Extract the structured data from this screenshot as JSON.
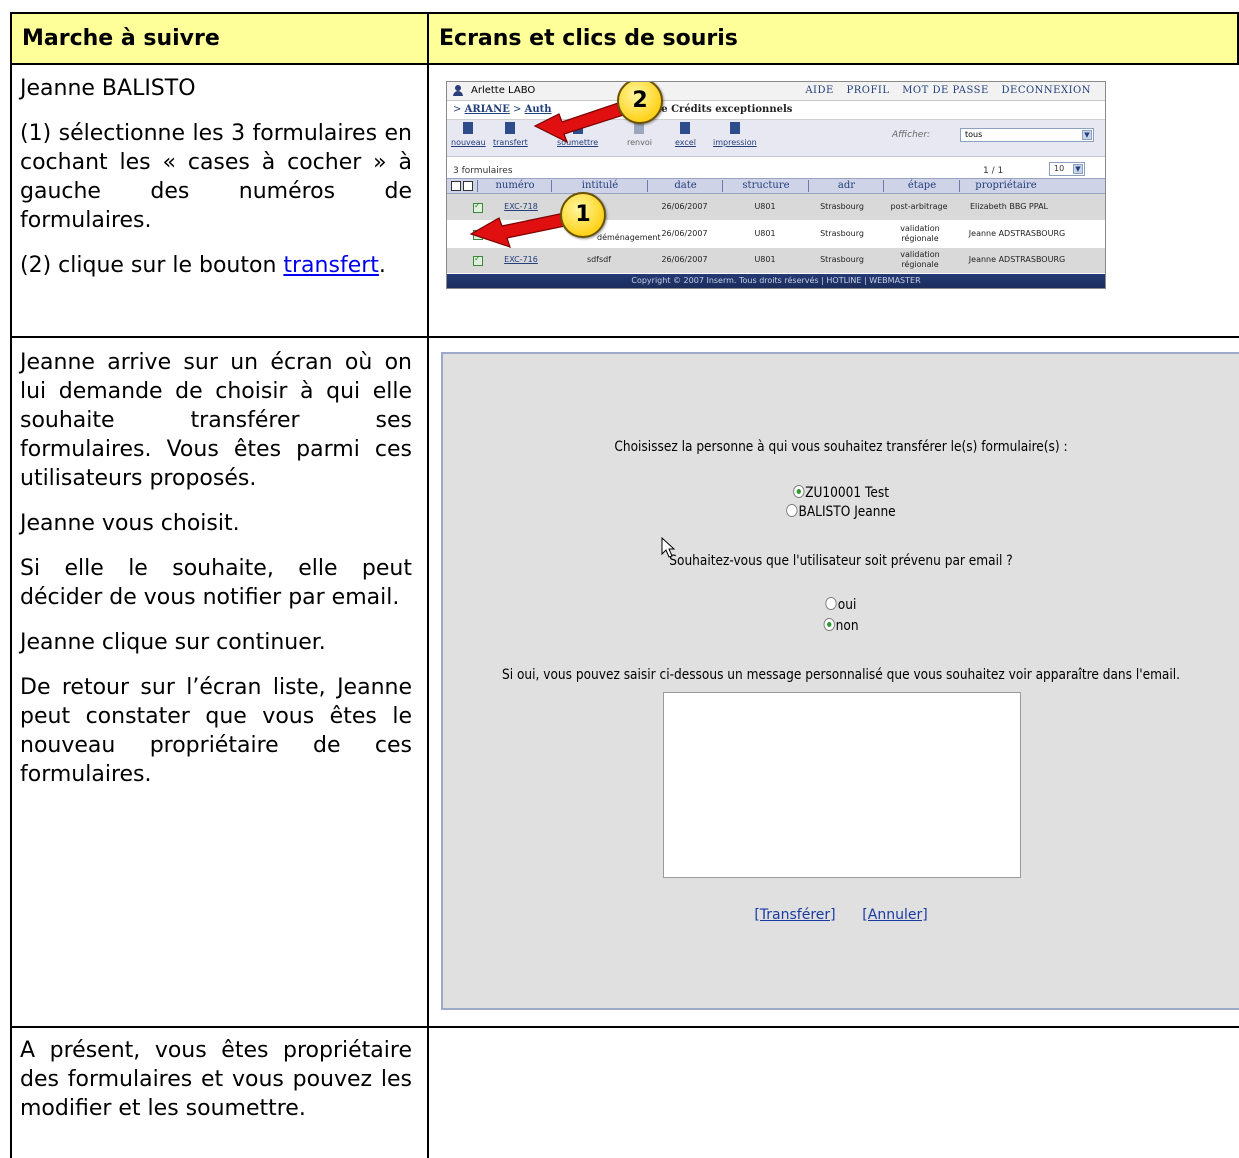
{
  "table": {
    "header_col1": "Marche à suivre",
    "header_col2": "Ecrans et clics de souris",
    "row1": {
      "p1": "Jeanne BALISTO",
      "p2": "(1) sélectionne les 3 formulaires en cochant les « cases à cocher » à gauche des numéros de formulaires.",
      "p3_before": "(2) clique sur le bouton ",
      "p3_link": "transfert",
      "p3_after": "."
    },
    "row2": {
      "p1": "Jeanne arrive sur un écran où on lui demande de choisir à qui elle souhaite transférer ses formulaires. Vous êtes parmi ces utilisateurs proposés.",
      "p2": "Jeanne vous choisit.",
      "p3": "Si elle le souhaite, elle peut décider de vous notifier par email.",
      "p4": "Jeanne clique sur continuer.",
      "p5": "De retour sur l’écran liste, Jeanne peut constater que vous êtes le nouveau propriétaire de ces formulaires."
    },
    "row3": {
      "p1": "A présent, vous êtes propriétaire des formulaires et vous pouvez les modifier et les soumettre."
    }
  },
  "screenshot1": {
    "user": "Arlette LABO",
    "top_links": [
      "AIDE",
      "PROFIL",
      "MOT DE PASSE",
      "DECONNEXION"
    ],
    "breadcrumb_home": "ARIANE",
    "breadcrumb_next": "Auth",
    "breadcrumb_current": "ste Crédits exceptionnels",
    "toolbar": [
      "nouveau",
      "transfert",
      "soumettre",
      "renvoi",
      "excel",
      "impression"
    ],
    "afficher_label": "Afficher:",
    "afficher_value": "tous",
    "count": "3 formulaires",
    "page": "1 / 1",
    "per_page": "10",
    "columns": [
      "numéro",
      "intitulé",
      "date",
      "structure",
      "adr",
      "étape",
      "propriétaire"
    ],
    "rows": [
      {
        "numero": "EXC-718",
        "intitule": "",
        "date": "26/06/2007",
        "structure": "U801",
        "adr": "Strasbourg",
        "etape": "post-arbitrage",
        "proprietaire": "Elizabeth BBG PPAL"
      },
      {
        "numero": "",
        "intitule": "déménagement",
        "date": "26/06/2007",
        "structure": "U801",
        "adr": "Strasbourg",
        "etape": "validation régionale",
        "proprietaire": "Jeanne ADSTRASBOURG"
      },
      {
        "numero": "EXC-716",
        "intitule": "sdfsdf",
        "date": "26/06/2007",
        "structure": "U801",
        "adr": "Strasbourg",
        "etape": "validation régionale",
        "proprietaire": "Jeanne ADSTRASBOURG"
      }
    ],
    "footer": "Copyright © 2007 Inserm. Tous droits réservés | HOTLINE | WEBMASTER",
    "badge1": "1",
    "badge2": "2"
  },
  "screenshot2": {
    "question1": "Choisissez la personne à qui vous souhaitez transférer le(s) formulaire(s) :",
    "option1": "ZU10001 Test",
    "option2": "BALISTO Jeanne",
    "question2": "Souhaitez-vous que l'utilisateur soit prévenu par email ?",
    "oui": "oui",
    "non": "non",
    "message_prompt": "Si oui, vous pouvez saisir ci-dessous un message personnalisé que vous souhaitez voir apparaître dans l'email.",
    "transfer_link": "[Transférer]",
    "cancel_link": "[Annuler]"
  },
  "colors": {
    "header_bg": "#ffff99",
    "arrow": "#e01010",
    "badge": "#ffd21c"
  }
}
